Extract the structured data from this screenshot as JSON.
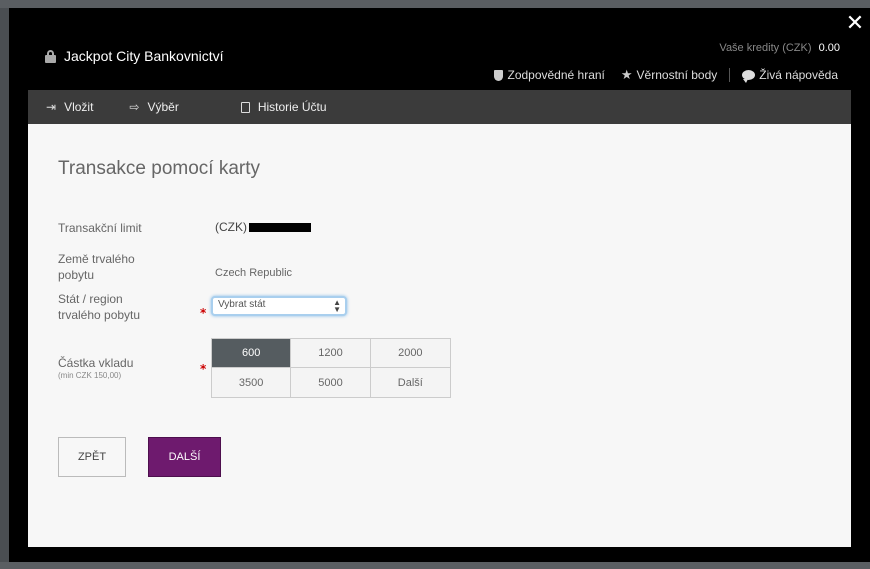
{
  "window": {
    "title": "Jackpot City Bankovnictví",
    "close_glyph": "✕"
  },
  "credits": {
    "label": "Vaše kredity (CZK)",
    "value": "0.00"
  },
  "top_links": [
    {
      "label": "Zodpovědné hraní",
      "icon": "shield-icon"
    },
    {
      "label": "Věrnostní body",
      "icon": "star-icon"
    },
    {
      "label": "Živá nápověda",
      "icon": "chat-icon"
    }
  ],
  "tabs": [
    {
      "label": "Vložit",
      "icon": "sign-in-icon"
    },
    {
      "label": "Výběr",
      "icon": "sign-out-icon"
    },
    {
      "label": "Historie Účtu",
      "icon": "document-icon"
    }
  ],
  "form": {
    "title": "Transakce pomocí karty",
    "limit_label": "Transakční limit",
    "limit_currency": "(CZK)",
    "country_label": "Země trvalého pobytu",
    "country_value": "Czech Republic",
    "state_label": "Stát / region trvalého pobytu",
    "state_select_value": "Vybrat stát",
    "amount_label": "Částka vkladu",
    "amount_min": "(min CZK 150,00)",
    "amounts": [
      "600",
      "1200",
      "2000",
      "3500",
      "5000",
      "Další"
    ],
    "selected_amount": "600",
    "required_mark": "*"
  },
  "buttons": {
    "back_label": "ZPĚT",
    "next_label": "DALŠÍ"
  },
  "colors": {
    "accent": "#6e1a6e",
    "modal_bg": "#000000",
    "content_bg": "#f7f7f7",
    "selected_amount_bg": "#555c60",
    "required": "#cc0000"
  }
}
